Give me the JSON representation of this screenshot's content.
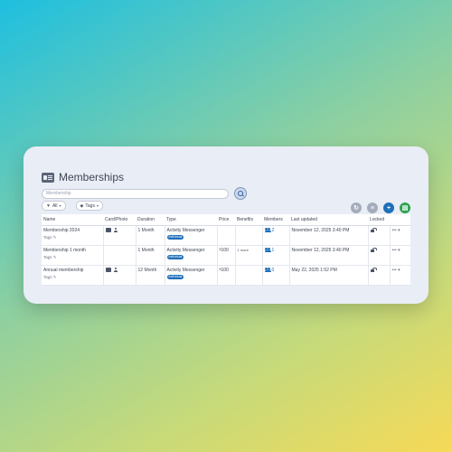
{
  "page": {
    "title": "Memberships"
  },
  "search": {
    "placeholder": "Membership"
  },
  "filters": {
    "all_label": "All",
    "tags_label": "Tags"
  },
  "table": {
    "headers": [
      "Name",
      "Card/Photo",
      "Duration",
      "Type",
      "Price",
      "Benefits",
      "Members",
      "Last updated",
      "Locked",
      ""
    ],
    "rows": [
      {
        "name": "Membership 2024",
        "tags": "Tags",
        "duration": "1 Month",
        "type": "Activity Messenger",
        "badge": "Individual",
        "price": "",
        "currency": "",
        "benefits": "",
        "members": "2",
        "updated": "November 12, 2025 3:40 PM",
        "more": "••• ▾"
      },
      {
        "name": "Membership 1 month",
        "tags": "Tags",
        "duration": "1 Month",
        "type": "Activity Messenger",
        "badge": "Individual",
        "price": "100",
        "currency": "$",
        "benefits": "1 more",
        "members": "1",
        "updated": "November 12, 2025 3:40 PM",
        "more": "••• ▾"
      },
      {
        "name": "Annual membership",
        "tags": "Tags",
        "duration": "12 Month",
        "type": "Activity Messenger",
        "badge": "Individual",
        "price": "100",
        "currency": "$",
        "benefits": "",
        "members": "0",
        "updated": "May 22, 2025 1:52 PM",
        "more": "••• ▾"
      }
    ]
  },
  "colors": {
    "accent": "#1f6fb8",
    "success": "#2ea352",
    "muted": "#a4acbc"
  },
  "icons": {
    "title": "id-card-icon",
    "search": "search-icon",
    "refresh": "refresh-icon",
    "columns": "columns-icon",
    "add": "plus-icon",
    "export": "excel-icon"
  }
}
